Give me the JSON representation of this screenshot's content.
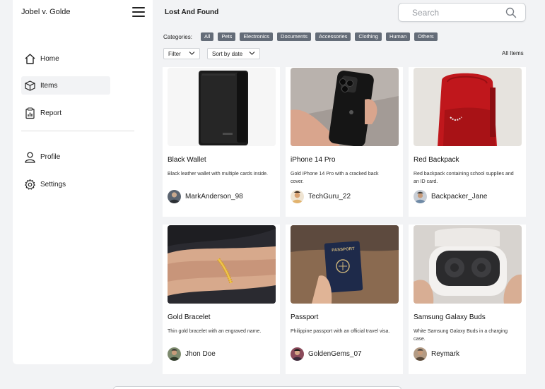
{
  "sidebar": {
    "brand": "Jobel v. Golde",
    "items": [
      {
        "label": "Home",
        "icon": "home-icon"
      },
      {
        "label": "Items",
        "icon": "box-icon"
      },
      {
        "label": "Report",
        "icon": "report-icon"
      },
      {
        "label": "Profile",
        "icon": "user-icon"
      },
      {
        "label": "Settings",
        "icon": "gear-icon"
      }
    ],
    "active": "Items"
  },
  "header": {
    "title": "Lost And Found",
    "search_placeholder": "Search"
  },
  "filters": {
    "categories_label": "Categories:",
    "categories": [
      "All",
      "Pets",
      "Electronics",
      "Documents",
      "Accessories",
      "Clothing",
      "Human",
      "Others"
    ],
    "filter_label": "Filter",
    "sort_label": "Sort by date",
    "view_label": "All Items"
  },
  "colors": {
    "chip": "#646c78",
    "background": "#f2f3f5",
    "card": "#ffffff"
  },
  "cards": [
    {
      "title": "Black Wallet",
      "desc": "Black leather wallet with multiple cards inside.",
      "user": "MarkAnderson_98"
    },
    {
      "title": "iPhone 14 Pro",
      "desc": "Gold iPhone 14 Pro with a cracked back cover.",
      "user": "TechGuru_22"
    },
    {
      "title": "Red Backpack",
      "desc": "Red backpack containing school supplies and an ID card.",
      "user": "Backpacker_Jane"
    },
    {
      "title": "Gold Bracelet",
      "desc": "Thin gold bracelet with an engraved name.",
      "user": "Jhon Doe"
    },
    {
      "title": "Passport",
      "desc": "Philippine passport with an official travel visa.",
      "user": "GoldenGems_07"
    },
    {
      "title": "Samsung Galaxy Buds",
      "desc": "White Samsung Galaxy Buds in a charging case.",
      "user": "Reymark"
    }
  ],
  "images": {
    "passport_text": "PASSPORT"
  }
}
